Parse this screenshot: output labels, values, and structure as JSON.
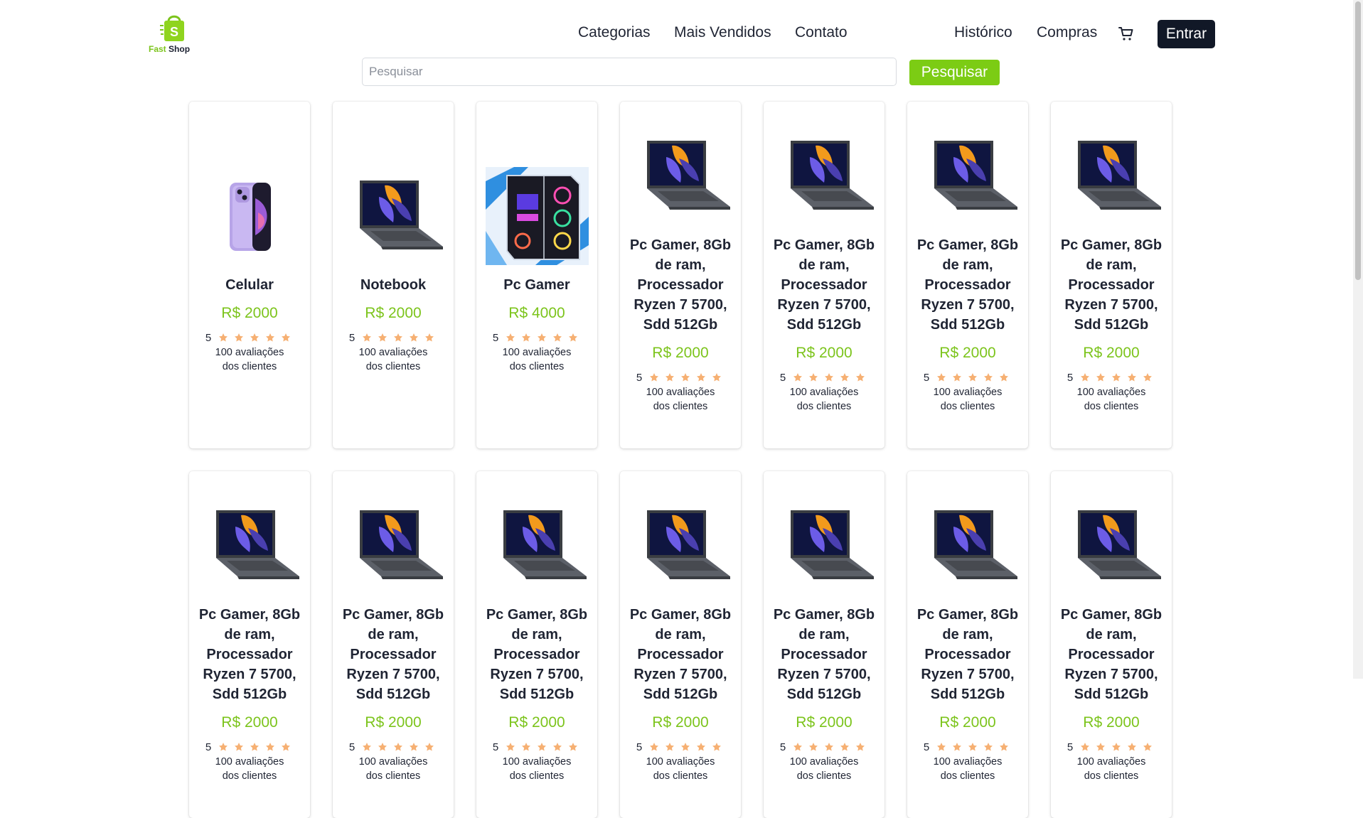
{
  "header": {
    "logo": {
      "fast": "Fast",
      "shop": "Shop",
      "bag_letter": "S"
    },
    "nav_left": [
      "Categorias",
      "Mais Vendidos",
      "Contato"
    ],
    "nav_right": [
      "Histórico",
      "Compras"
    ],
    "cart_icon": "shopping-cart-icon",
    "login_label": "Entrar"
  },
  "search": {
    "placeholder": "Pesquisar",
    "value": "",
    "button_label": "Pesquisar"
  },
  "colors": {
    "accent": "#7cc41c",
    "dark": "#111827",
    "star": "#f6b073"
  },
  "products": [
    {
      "image": "phone",
      "title": "Celular",
      "price": "R$ 2000",
      "rating": "5",
      "reviews": "100 avaliações dos clientes"
    },
    {
      "image": "laptop",
      "title": "Notebook",
      "price": "R$ 2000",
      "rating": "5",
      "reviews": "100 avaliações dos clientes"
    },
    {
      "image": "pc",
      "title": "Pc Gamer",
      "price": "R$ 4000",
      "rating": "5",
      "reviews": "100 avaliações dos clientes"
    },
    {
      "image": "laptop",
      "title": "Pc Gamer, 8Gb de ram, Processador Ryzen 7 5700, Sdd 512Gb",
      "price": "R$ 2000",
      "rating": "5",
      "reviews": "100 avaliações dos clientes"
    },
    {
      "image": "laptop",
      "title": "Pc Gamer, 8Gb de ram, Processador Ryzen 7 5700, Sdd 512Gb",
      "price": "R$ 2000",
      "rating": "5",
      "reviews": "100 avaliações dos clientes"
    },
    {
      "image": "laptop",
      "title": "Pc Gamer, 8Gb de ram, Processador Ryzen 7 5700, Sdd 512Gb",
      "price": "R$ 2000",
      "rating": "5",
      "reviews": "100 avaliações dos clientes"
    },
    {
      "image": "laptop",
      "title": "Pc Gamer, 8Gb de ram, Processador Ryzen 7 5700, Sdd 512Gb",
      "price": "R$ 2000",
      "rating": "5",
      "reviews": "100 avaliações dos clientes"
    },
    {
      "image": "laptop",
      "title": "Pc Gamer, 8Gb de ram, Processador Ryzen 7 5700, Sdd 512Gb",
      "price": "R$ 2000",
      "rating": "5",
      "reviews": "100 avaliações dos clientes"
    },
    {
      "image": "laptop",
      "title": "Pc Gamer, 8Gb de ram, Processador Ryzen 7 5700, Sdd 512Gb",
      "price": "R$ 2000",
      "rating": "5",
      "reviews": "100 avaliações dos clientes"
    },
    {
      "image": "laptop",
      "title": "Pc Gamer, 8Gb de ram, Processador Ryzen 7 5700, Sdd 512Gb",
      "price": "R$ 2000",
      "rating": "5",
      "reviews": "100 avaliações dos clientes"
    },
    {
      "image": "laptop",
      "title": "Pc Gamer, 8Gb de ram, Processador Ryzen 7 5700, Sdd 512Gb",
      "price": "R$ 2000",
      "rating": "5",
      "reviews": "100 avaliações dos clientes"
    },
    {
      "image": "laptop",
      "title": "Pc Gamer, 8Gb de ram, Processador Ryzen 7 5700, Sdd 512Gb",
      "price": "R$ 2000",
      "rating": "5",
      "reviews": "100 avaliações dos clientes"
    },
    {
      "image": "laptop",
      "title": "Pc Gamer, 8Gb de ram, Processador Ryzen 7 5700, Sdd 512Gb",
      "price": "R$ 2000",
      "rating": "5",
      "reviews": "100 avaliações dos clientes"
    },
    {
      "image": "laptop",
      "title": "Pc Gamer, 8Gb de ram, Processador Ryzen 7 5700, Sdd 512Gb",
      "price": "R$ 2000",
      "rating": "5",
      "reviews": "100 avaliações dos clientes"
    }
  ]
}
